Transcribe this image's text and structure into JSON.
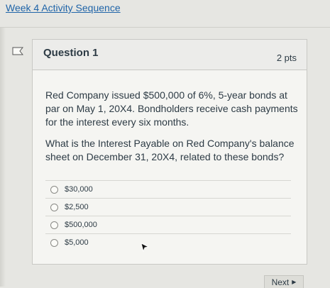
{
  "breadcrumb": {
    "label": "Week 4 Activity Sequence"
  },
  "question": {
    "title": "Question 1",
    "points": "2 pts",
    "body_paragraphs": [
      "Red Company issued $500,000 of 6%, 5-year bonds at par on May 1, 20X4. Bondholders receive cash payments for the interest every six months.",
      "What is the Interest Payable on Red Company's balance sheet on December 31, 20X4, related to these bonds?"
    ],
    "answers": [
      {
        "label": "$30,000",
        "selected": false
      },
      {
        "label": "$2,500",
        "selected": false
      },
      {
        "label": "$500,000",
        "selected": false
      },
      {
        "label": "$5,000",
        "selected": false
      }
    ]
  },
  "navigation": {
    "next_label": "Next",
    "next_icon": "caret-right-icon"
  },
  "icons": {
    "flag": "bookmark-flag-icon",
    "cursor": "mouse-pointer-icon"
  },
  "colors": {
    "link": "#1f64a8",
    "text": "#2d3b45",
    "background": "#e6e6e2"
  }
}
